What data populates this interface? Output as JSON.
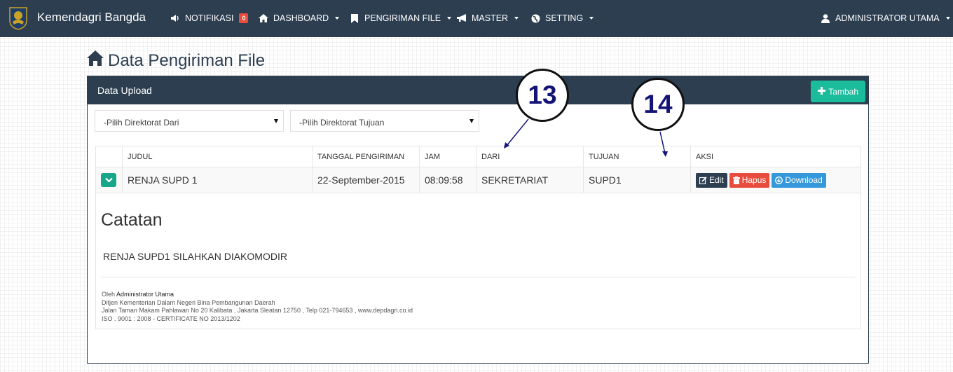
{
  "navbar": {
    "brand": "Kemendagri Bangda",
    "items": [
      {
        "label": "NOTIFIKASI",
        "badge": "0",
        "icon": "volume-icon"
      },
      {
        "label": "DASHBOARD",
        "icon": "home-icon"
      },
      {
        "label": "PENGIRIMAN FILE",
        "icon": "bookmark-icon"
      },
      {
        "label": "MASTER",
        "icon": "megaphone-icon"
      },
      {
        "label": "SETTING",
        "icon": "globe-icon"
      }
    ],
    "user": {
      "label": "ADMINISTRATOR UTAMA",
      "icon": "user-icon"
    }
  },
  "page": {
    "title": "Data Pengiriman File",
    "icon": "home-icon"
  },
  "panel": {
    "title": "Data Upload",
    "add_button": "Tambah"
  },
  "filters": {
    "dari": "-Pilih Direktorat Dari",
    "tujuan": "-Pilih Direktorat Tujuan"
  },
  "table": {
    "headers": [
      "",
      "JUDUL",
      "TANGGAL PENGIRIMAN",
      "JAM",
      "DARI",
      "TUJUAN",
      "AKSI"
    ],
    "rows": [
      {
        "judul": "RENJA SUPD 1",
        "tanggal": "22-September-2015",
        "jam": "08:09:58",
        "dari": "SEKRETARIAT",
        "tujuan": "SUPD1",
        "actions": {
          "edit": "Edit",
          "hapus": "Hapus",
          "download": "Download"
        }
      }
    ]
  },
  "detail": {
    "title": "Catatan",
    "text": "RENJA SUPD1 SILAHKAN DIAKOMODIR",
    "footer": {
      "oleh_prefix": "Oleh",
      "oleh_name": "Administrator Utama",
      "line2": "Ditjen Kementerian Dalam Negeri Bina Pembangunan Daerah",
      "line3": "Jalan Taman Makam Pahlawan No 20 Kalibata , Jakarta Sleatan 12750 , Telp 021-794653 , www.depdagri.co.id",
      "line4": "ISO . 9001 : 2008 - CERTIFICATE NO 2013/1202"
    }
  },
  "annotations": [
    "13",
    "14"
  ],
  "colors": {
    "navbar": "#2c3e50",
    "accent_green": "#1abc9c",
    "danger": "#e74c3c",
    "info": "#3498db",
    "annotation_text": "#141477"
  }
}
